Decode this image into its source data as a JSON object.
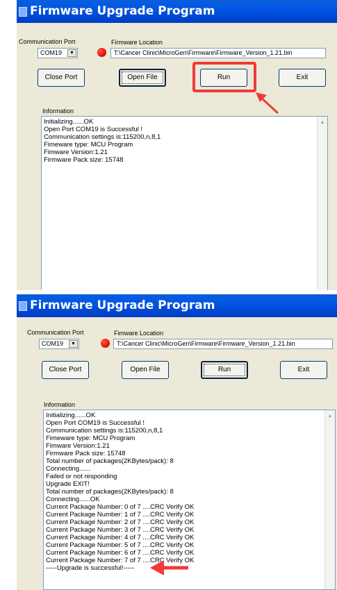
{
  "window1": {
    "title": "Firmware Upgrade Program",
    "port_label": "Communication Port",
    "port_value": "COM19",
    "fw_label": "Firmware Location",
    "fw_path": "T:\\Cancer Clinic\\MicroGen\\Firmware\\Firmware_Version_1.21.bin",
    "buttons": {
      "close_port": "Close Port",
      "open_file": "Open File",
      "run": "Run",
      "exit": "Exit"
    },
    "info_label": "Information",
    "info_lines": [
      "Initializing......OK",
      "Open Port COM19 is Successful !",
      "Communication settings is:115200,n,8,1",
      "Fimeware type: MCU Program",
      "Fimware Version:1.21",
      "Firmware Pack size: 15748"
    ]
  },
  "window2": {
    "title": "Firmware Upgrade Program",
    "port_label": "Communication Port",
    "port_value": "COM19",
    "fw_label": "Fimware Location",
    "fw_path": "T:\\Cancer Clinic\\MicroGen\\Firmware\\Firmware_Version_1.21.bin",
    "buttons": {
      "close_port": "Close Port",
      "open_file": "Open File",
      "run": "Run",
      "exit": "Exit"
    },
    "info_label": "Information",
    "info_lines": [
      "Initializing......OK",
      "Open Port COM19 is Successful !",
      "Communication settings is:115200,n,8,1",
      "Fimeware type: MCU Program",
      "Fimware Version:1.21",
      "Firmware Pack size: 15748",
      "Total number of packages(2KBytes/pack): 8",
      "Connecting......",
      "Failed or not responding",
      "Upgrade EXIT!",
      "Total number of packages(2KBytes/pack): 8",
      "Connecting......OK",
      "Current Package Number:  0 of 7 ....CRC Verify OK",
      "Current Package Number:  1 of 7 ....CRC Verify OK",
      "Current Package Number:  2 of 7 ....CRC Verify OK",
      "Current Package Number:  3 of 7 ....CRC Verify OK",
      "Current Package Number:  4 of 7 ....CRC Verify OK",
      "Current Package Number:  5 of 7 ....CRC Verify OK",
      "Current Package Number:  6 of 7 ....CRC Verify OK",
      "Current Package Number:  7 of 7 ....CRC Verify OK",
      "-----Upgrade is successful!-----"
    ]
  },
  "icons": {
    "led": "red-status-led-icon",
    "arrow": "red-annotation-arrow-icon",
    "dropdown": "chevron-down-icon"
  },
  "colors": {
    "titlebar": "#0054e3",
    "window_bg": "#ece9d8",
    "annotation": "#f03a3a",
    "led": "#e01400"
  }
}
